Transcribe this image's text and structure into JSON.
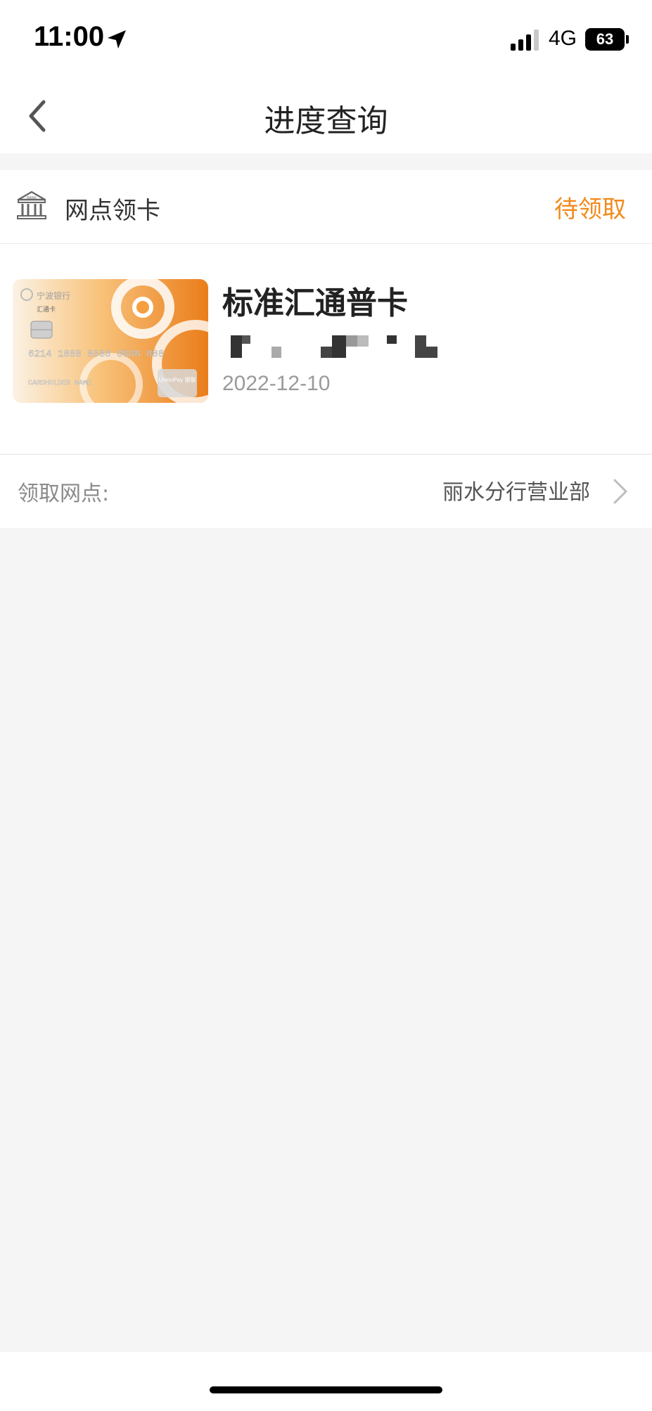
{
  "status_bar": {
    "time": "11:00",
    "network": "4G",
    "battery": "63",
    "icons": [
      "location-arrow-icon",
      "signal-bars-icon",
      "battery-icon"
    ]
  },
  "navbar": {
    "title": "进度查询",
    "back_icon": "chevron-left-icon"
  },
  "pickup": {
    "method_label": "网点领卡",
    "method_icon": "bank-building-icon",
    "status": "待领取",
    "status_color": "#f18a1c"
  },
  "card": {
    "product_name": "标准汇通普卡",
    "apply_date": "2022-12-10",
    "image": {
      "bank_name": "宁波银行",
      "card_brand": "汇通卡",
      "card_number": "6214 1888 8888 8888 888",
      "holder": "CARDHOLDER NAME",
      "network": "UnionPay 银联",
      "accent_color": "#f08a24"
    }
  },
  "branch": {
    "label": "领取网点:",
    "value": "丽水分行营业部",
    "arrow_icon": "chevron-right-icon"
  }
}
